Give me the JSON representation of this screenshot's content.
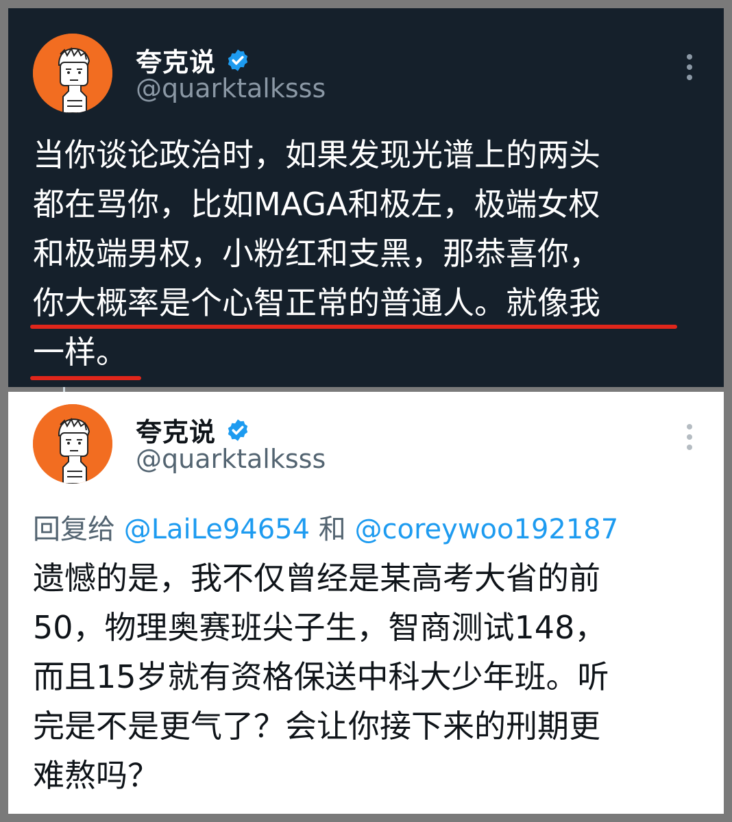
{
  "tweets": [
    {
      "author_name": "夸克说",
      "author_handle": "@quarktalksss",
      "verified": true,
      "theme": "dark",
      "text_lines": [
        "当你谈论政治时，如果发现光谱上的两头",
        "都在骂你，比如MAGA和极左，极端女权",
        "和极端男权，小粉红和支黑，那恭喜你，",
        "你大概率是个心智正常的普通人。就像我",
        "一样。"
      ],
      "highlight_color": "#e0261b"
    },
    {
      "author_name": "夸克说",
      "author_handle": "@quarktalksss",
      "verified": true,
      "theme": "light",
      "reply_prefix": "回复给",
      "reply_user_1": "@LaiLe94654",
      "reply_joiner": "和",
      "reply_user_2": "@coreywoo192187",
      "text_lines": [
        "遗憾的是，我不仅曾经是某高考大省的前",
        "50，物理奥赛班尖子生，智商测试148，",
        "而且15岁就有资格保送中科大少年班。听",
        "完是不是更气了？会让你接下来的刑期更",
        "难熬吗？"
      ]
    }
  ],
  "icons": {
    "verified": "verified-badge-icon",
    "more": "more-vertical-icon",
    "avatar": "cartoon-avatar"
  },
  "colors": {
    "dark_bg": "#15202b",
    "light_bg": "#ffffff",
    "accent_blue": "#1d9bf0",
    "avatar_orange": "#f26d21"
  }
}
